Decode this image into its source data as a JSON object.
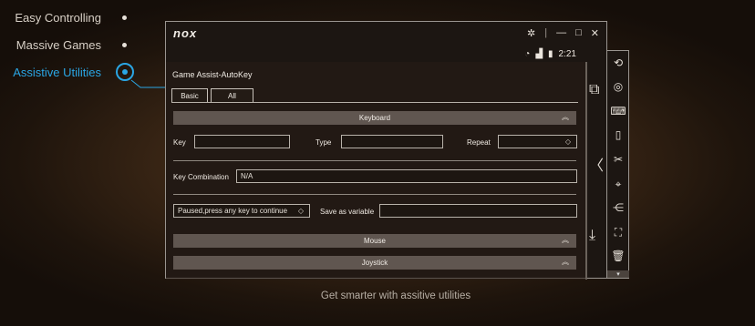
{
  "nav": {
    "items": [
      {
        "label": "Easy Controlling"
      },
      {
        "label": "Massive Games"
      },
      {
        "label": "Assistive Utilities"
      }
    ]
  },
  "window": {
    "logo": "nox",
    "controls": {
      "settings": "✲",
      "minimize": "—",
      "maximize": "□",
      "close": "✕"
    }
  },
  "status": {
    "wifi": "◔",
    "signal": "▟",
    "battery": "▮",
    "time": "2:21"
  },
  "app": {
    "title": "Game Assist-AutoKey",
    "tabs": [
      {
        "label": "Basic"
      },
      {
        "label": "All"
      }
    ],
    "sections": {
      "keyboard": "Keyboard",
      "mouse": "Mouse",
      "joystick": "Joystick"
    },
    "fields": {
      "key_label": "Key",
      "type_label": "Type",
      "repeat_label": "Repeat",
      "combo_label": "Key  Combination",
      "combo_value": "N/A",
      "pause_value": "Paused,press any key to continue",
      "save_label": "Save as variable"
    }
  },
  "caption": "Get smarter with assitive utilities",
  "colors": {
    "accent": "#2aa6e4"
  }
}
